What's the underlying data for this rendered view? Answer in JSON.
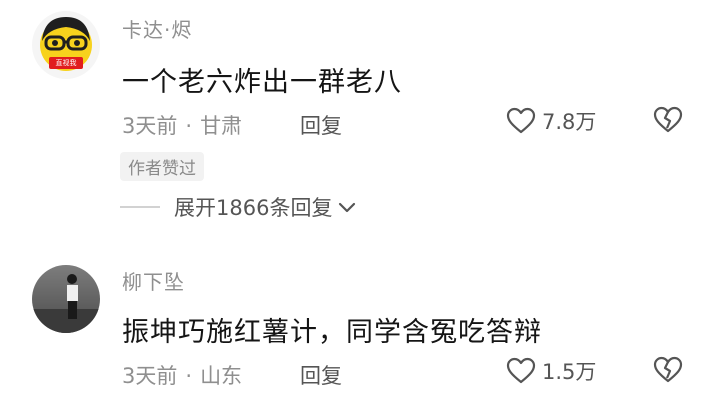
{
  "comments": [
    {
      "username": "卡达·烬",
      "avatar_badge": "直视我",
      "text": "一个老六炸出一群老八",
      "time": "3天前",
      "location": "甘肃",
      "reply_label": "回复",
      "likes": "7.8万",
      "author_liked_badge": "作者赞过",
      "expand_label": "展开1866条回复"
    },
    {
      "username": "柳下坠",
      "text": "振坤巧施红薯计，同学含冤吃答辩",
      "time": "3天前",
      "location": "山东",
      "reply_label": "回复",
      "likes": "1.5万"
    }
  ],
  "meta_separator": "·",
  "icons": [
    "heart-outline-icon",
    "broken-heart-icon",
    "chevron-down-icon"
  ],
  "colors": {
    "username": "#8f8f8f",
    "text": "#151515",
    "secondary": "#555555",
    "badge_bg": "#f2f2f2"
  }
}
